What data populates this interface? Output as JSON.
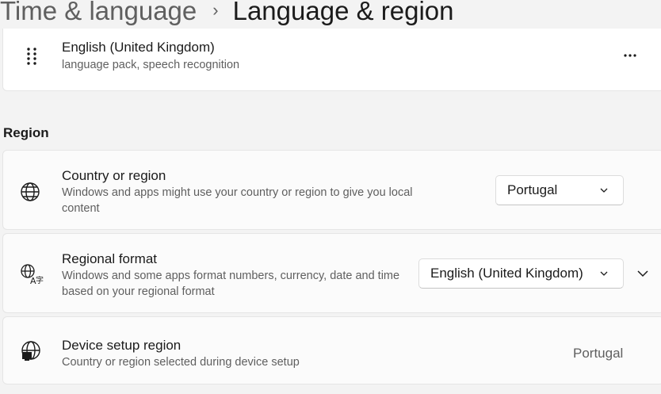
{
  "breadcrumb": {
    "parent": "Time & language",
    "separator": "›",
    "current": "Language & region"
  },
  "language_card": {
    "title": "English (United Kingdom)",
    "subtitle": "language pack, speech recognition",
    "drag_icon": "drag-handle-icon",
    "more_icon": "more-options-icon"
  },
  "region_section": {
    "title": "Region"
  },
  "country": {
    "title": "Country or region",
    "subtitle": "Windows and apps might use your country or region to give you local content",
    "value": "Portugal",
    "icon": "globe-icon"
  },
  "regional_format": {
    "title": "Regional format",
    "subtitle": "Windows and some apps format numbers, currency, date and time based on your regional format",
    "value": "English (United Kingdom)",
    "icon": "language-format-icon",
    "expand_icon": "chevron-down-icon"
  },
  "device_region": {
    "title": "Device setup region",
    "subtitle": "Country or region selected during device setup",
    "value": "Portugal",
    "icon": "globe-device-icon"
  },
  "colors": {
    "background": "#f3f3f3",
    "card": "#fbfbfb",
    "text": "#1b1b1b",
    "secondary_text": "#5f5f5f"
  }
}
